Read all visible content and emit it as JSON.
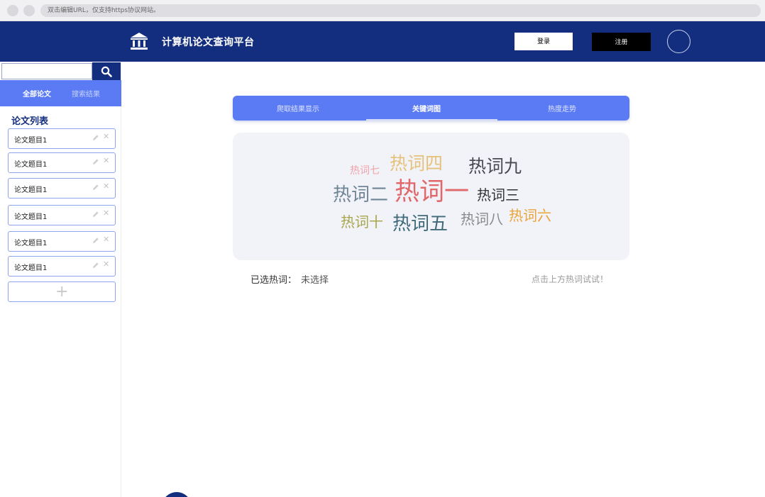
{
  "browser": {
    "url_placeholder": "双击编辑URL，仅支持https协议网站。"
  },
  "header": {
    "title": "计算机论文查询平台",
    "login_label": "登录",
    "register_label": "注册",
    "bg_color": "#132e7e"
  },
  "sidebar": {
    "search_value": "",
    "tabs": [
      {
        "label": "全部论文",
        "active": true
      },
      {
        "label": "搜索结果",
        "active": false
      }
    ],
    "list_title": "论文列表",
    "papers": [
      {
        "name": "论文题目1"
      },
      {
        "name": "论文题目1"
      },
      {
        "name": "论文题目1"
      },
      {
        "name": "论文题目1"
      },
      {
        "name": "论文题目1"
      },
      {
        "name": "论文题目1"
      }
    ],
    "add_label": "+",
    "accent_color": "#5b7bf5"
  },
  "main": {
    "tabs": [
      {
        "label": "爬取结果显示",
        "active": false
      },
      {
        "label": "关键词图",
        "active": true
      },
      {
        "label": "热度走势",
        "active": false
      }
    ],
    "word_cloud": [
      {
        "text": "热词七",
        "color": "#f0a3a8"
      },
      {
        "text": "热词四",
        "color": "#e6c17a"
      },
      {
        "text": "热词九",
        "color": "#4a4a55"
      },
      {
        "text": "热词二",
        "color": "#6f8596"
      },
      {
        "text": "热词一",
        "color": "#e0676a"
      },
      {
        "text": "热词三",
        "color": "#333333"
      },
      {
        "text": "热词十",
        "color": "#a8a64a"
      },
      {
        "text": "热词五",
        "color": "#3e6a7a"
      },
      {
        "text": "热词八",
        "color": "#8a8a8a"
      },
      {
        "text": "热词六",
        "color": "#eaa43a"
      }
    ],
    "selected_label": "已选热词：",
    "selected_value": "未选择",
    "hint": "点击上方热词试试！"
  }
}
